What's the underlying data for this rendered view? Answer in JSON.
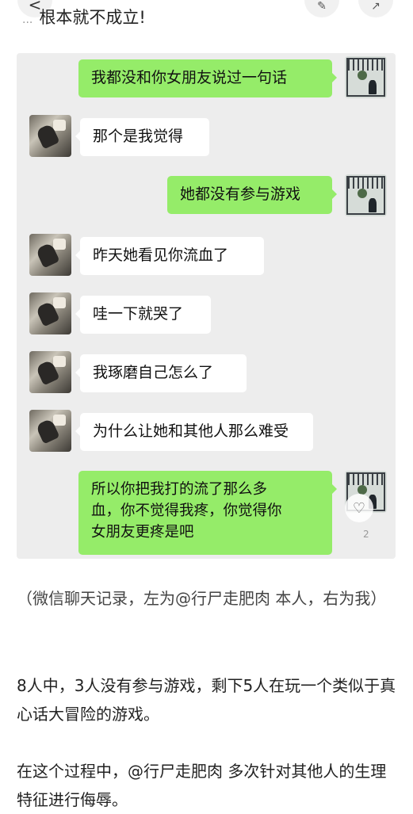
{
  "topbar": {
    "back_icon": "chevron-left-icon",
    "prev_fragment": "...",
    "prev_text": "根本就不成立!",
    "edit_icon": "edit-icon",
    "share_icon": "share-icon"
  },
  "chat": {
    "messages": [
      {
        "side": "right",
        "text": "我都没和你女朋友说过一句话"
      },
      {
        "side": "left",
        "text": "那个是我觉得"
      },
      {
        "side": "right",
        "text": "她都没有参与游戏"
      },
      {
        "side": "left",
        "text": "昨天她看见你流血了"
      },
      {
        "side": "left",
        "text": "哇一下就哭了"
      },
      {
        "side": "left",
        "text": "我琢磨自己怎么了"
      },
      {
        "side": "left",
        "text": "为什么让她和其他人那么难受"
      },
      {
        "side": "right",
        "text": "所以你把我打的流了那么多\n血，你不觉得我疼，你觉得你\n女朋友更疼是吧"
      }
    ],
    "like_icon": "heart-icon",
    "like_count": "2"
  },
  "article": {
    "caption": "（微信聊天记录，左为@行尸走肥肉 本人，右为我）",
    "p1": "8人中，3人没有参与游戏，剩下5人在玩一个类似于真心话大冒险的游戏。",
    "p2": "在这个过程中，@行尸走肥肉 多次针对其他人的生理特征进行侮辱。"
  },
  "colors": {
    "chat_bg": "#ededed",
    "out_bubble": "#95ec69",
    "in_bubble": "#ffffff"
  }
}
